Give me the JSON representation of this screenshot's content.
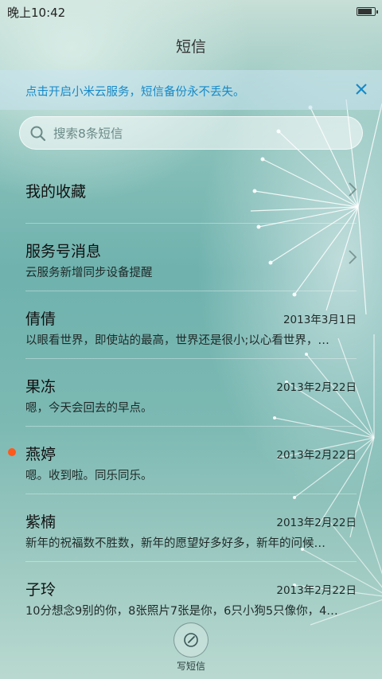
{
  "status_bar": {
    "time": "晚上10:42",
    "battery_level": 0.9
  },
  "header": {
    "title": "短信"
  },
  "banner": {
    "text": "点击开启小米云服务，短信备份永不丢失。"
  },
  "search": {
    "placeholder": "搜索8条短信"
  },
  "rows": [
    {
      "name": "我的收藏"
    },
    {
      "name": "服务号消息",
      "snippet": "云服务新增同步设备提醒"
    },
    {
      "name": "倩倩",
      "date": "2013年3月1日",
      "snippet": "以眼看世界，即使站的最高，世界还是很小;以心看世界，…"
    },
    {
      "name": "果冻",
      "date": "2013年2月22日",
      "snippet": "嗯，今天会回去的早点。"
    },
    {
      "name": "燕婷",
      "date": "2013年2月22日",
      "snippet": "嗯。收到啦。同乐同乐。"
    },
    {
      "name": "紫楠",
      "date": "2013年2月22日",
      "snippet": "新年的祝福数不胜数，新年的愿望好多好多，新年的问候…"
    },
    {
      "name": "子玲",
      "date": "2013年2月22日",
      "snippet": "10分想念9别的你，8张照片7张是你，6只小狗5只像你，4…"
    }
  ],
  "compose": {
    "label": "写短信"
  },
  "colors": {
    "accent": "#1589c8",
    "unread": "#ff5a1a"
  }
}
